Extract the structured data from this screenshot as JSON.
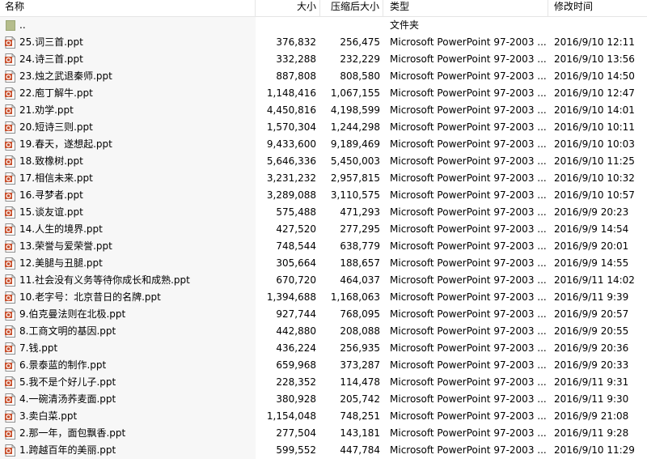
{
  "columns": {
    "name": "名称",
    "size": "大小",
    "compressed": "压缩后大小",
    "type": "类型",
    "modified": "修改时间"
  },
  "parent_row": {
    "name": "..",
    "type": "文件夹"
  },
  "files": [
    {
      "name": "25.词三首.ppt",
      "size": "376,832",
      "compressed": "256,475",
      "type": "Microsoft PowerPoint 97-2003 ...",
      "modified": "2016/9/10 12:11"
    },
    {
      "name": "24.诗三首.ppt",
      "size": "332,288",
      "compressed": "232,229",
      "type": "Microsoft PowerPoint 97-2003 ...",
      "modified": "2016/9/10 13:56"
    },
    {
      "name": "23.烛之武退秦师.ppt",
      "size": "887,808",
      "compressed": "808,580",
      "type": "Microsoft PowerPoint 97-2003 ...",
      "modified": "2016/9/10 14:50"
    },
    {
      "name": "22.庖丁解牛.ppt",
      "size": "1,148,416",
      "compressed": "1,067,155",
      "type": "Microsoft PowerPoint 97-2003 ...",
      "modified": "2016/9/10 12:47"
    },
    {
      "name": "21.劝学.ppt",
      "size": "4,450,816",
      "compressed": "4,198,599",
      "type": "Microsoft PowerPoint 97-2003 ...",
      "modified": "2016/9/10 14:01"
    },
    {
      "name": "20.短诗三则.ppt",
      "size": "1,570,304",
      "compressed": "1,244,298",
      "type": "Microsoft PowerPoint 97-2003 ...",
      "modified": "2016/9/10 10:11"
    },
    {
      "name": "19.春天，遂想起.ppt",
      "size": "9,433,600",
      "compressed": "9,189,469",
      "type": "Microsoft PowerPoint 97-2003 ...",
      "modified": "2016/9/10 10:03"
    },
    {
      "name": "18.致橡树.ppt",
      "size": "5,646,336",
      "compressed": "5,450,003",
      "type": "Microsoft PowerPoint 97-2003 ...",
      "modified": "2016/9/10 11:25"
    },
    {
      "name": "17.相信未来.ppt",
      "size": "3,231,232",
      "compressed": "2,957,815",
      "type": "Microsoft PowerPoint 97-2003 ...",
      "modified": "2016/9/10 10:32"
    },
    {
      "name": "16.寻梦者.ppt",
      "size": "3,289,088",
      "compressed": "3,110,575",
      "type": "Microsoft PowerPoint 97-2003 ...",
      "modified": "2016/9/10 10:57"
    },
    {
      "name": "15.谈友谊.ppt",
      "size": "575,488",
      "compressed": "471,293",
      "type": "Microsoft PowerPoint 97-2003 ...",
      "modified": "2016/9/9 20:23"
    },
    {
      "name": "14.人生的境界.ppt",
      "size": "427,520",
      "compressed": "277,295",
      "type": "Microsoft PowerPoint 97-2003 ...",
      "modified": "2016/9/9 14:54"
    },
    {
      "name": "13.荣誉与爱荣誉.ppt",
      "size": "748,544",
      "compressed": "638,779",
      "type": "Microsoft PowerPoint 97-2003 ...",
      "modified": "2016/9/9 20:01"
    },
    {
      "name": "12.美腿与丑腿.ppt",
      "size": "305,664",
      "compressed": "188,657",
      "type": "Microsoft PowerPoint 97-2003 ...",
      "modified": "2016/9/9 14:55"
    },
    {
      "name": "11.社会没有义务等待你成长和成熟.ppt",
      "size": "670,720",
      "compressed": "464,037",
      "type": "Microsoft PowerPoint 97-2003 ...",
      "modified": "2016/9/11 14:02"
    },
    {
      "name": "10.老字号：北京昔日的名牌.ppt",
      "size": "1,394,688",
      "compressed": "1,168,063",
      "type": "Microsoft PowerPoint 97-2003 ...",
      "modified": "2016/9/11 9:39"
    },
    {
      "name": "9.伯克曼法则在北极.ppt",
      "size": "927,744",
      "compressed": "768,095",
      "type": "Microsoft PowerPoint 97-2003 ...",
      "modified": "2016/9/9 20:57"
    },
    {
      "name": "8.工商文明的基因.ppt",
      "size": "442,880",
      "compressed": "208,088",
      "type": "Microsoft PowerPoint 97-2003 ...",
      "modified": "2016/9/9 20:55"
    },
    {
      "name": "7.钱.ppt",
      "size": "436,224",
      "compressed": "256,935",
      "type": "Microsoft PowerPoint 97-2003 ...",
      "modified": "2016/9/9 20:36"
    },
    {
      "name": "6.景泰蓝的制作.ppt",
      "size": "659,968",
      "compressed": "373,287",
      "type": "Microsoft PowerPoint 97-2003 ...",
      "modified": "2016/9/9 20:33"
    },
    {
      "name": "5.我不是个好儿子.ppt",
      "size": "228,352",
      "compressed": "114,478",
      "type": "Microsoft PowerPoint 97-2003 ...",
      "modified": "2016/9/11 9:31"
    },
    {
      "name": "4.一碗清汤荞麦面.ppt",
      "size": "380,928",
      "compressed": "205,742",
      "type": "Microsoft PowerPoint 97-2003 ...",
      "modified": "2016/9/11 9:30"
    },
    {
      "name": "3.卖白菜.ppt",
      "size": "1,154,048",
      "compressed": "748,251",
      "type": "Microsoft PowerPoint 97-2003 ...",
      "modified": "2016/9/9 21:08"
    },
    {
      "name": "2.那一年，面包飘香.ppt",
      "size": "277,504",
      "compressed": "143,181",
      "type": "Microsoft PowerPoint 97-2003 ...",
      "modified": "2016/9/11 9:28"
    },
    {
      "name": "1.跨越百年的美丽.ppt",
      "size": "599,552",
      "compressed": "447,784",
      "type": "Microsoft PowerPoint 97-2003 ...",
      "modified": "2016/9/10 11:29"
    }
  ],
  "icons": {
    "file": "ppt-file-icon",
    "folder": "folder-icon"
  },
  "colors": {
    "ppt_icon": "#c8502d",
    "folder": "#b5bd8c",
    "name_column_bg": "#f7f7f7"
  }
}
